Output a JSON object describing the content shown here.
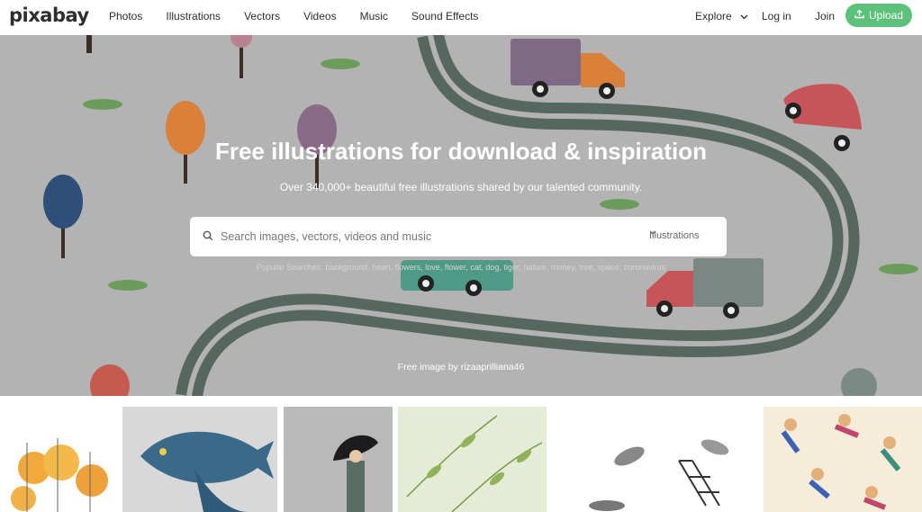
{
  "header": {
    "logo": "pixabay",
    "nav": [
      "Photos",
      "Illustrations",
      "Vectors",
      "Videos",
      "Music",
      "Sound Effects"
    ],
    "explore_label": "Explore",
    "login_label": "Log in",
    "join_label": "Join",
    "upload_label": "Upload"
  },
  "hero": {
    "title": "Free illustrations for download & inspiration",
    "subtitle": "Over 340,000+ beautiful free illustrations shared by our talented community.",
    "search": {
      "placeholder": "Search images, vectors, videos and music",
      "selected_type": "Illustrations"
    },
    "popular": "Popular Searches: background, heart, flowers, love, flower, cat, dog, tiger, nature, money, tree, space, coronavirus",
    "credit": "Free image by rizaaprilliana46"
  },
  "colors": {
    "accent_green": "#5cc17a",
    "hero_bg": "#b3b3b3",
    "road": "#56675f"
  },
  "icons": [
    "search-icon",
    "chevron-down-icon",
    "upload-icon"
  ]
}
